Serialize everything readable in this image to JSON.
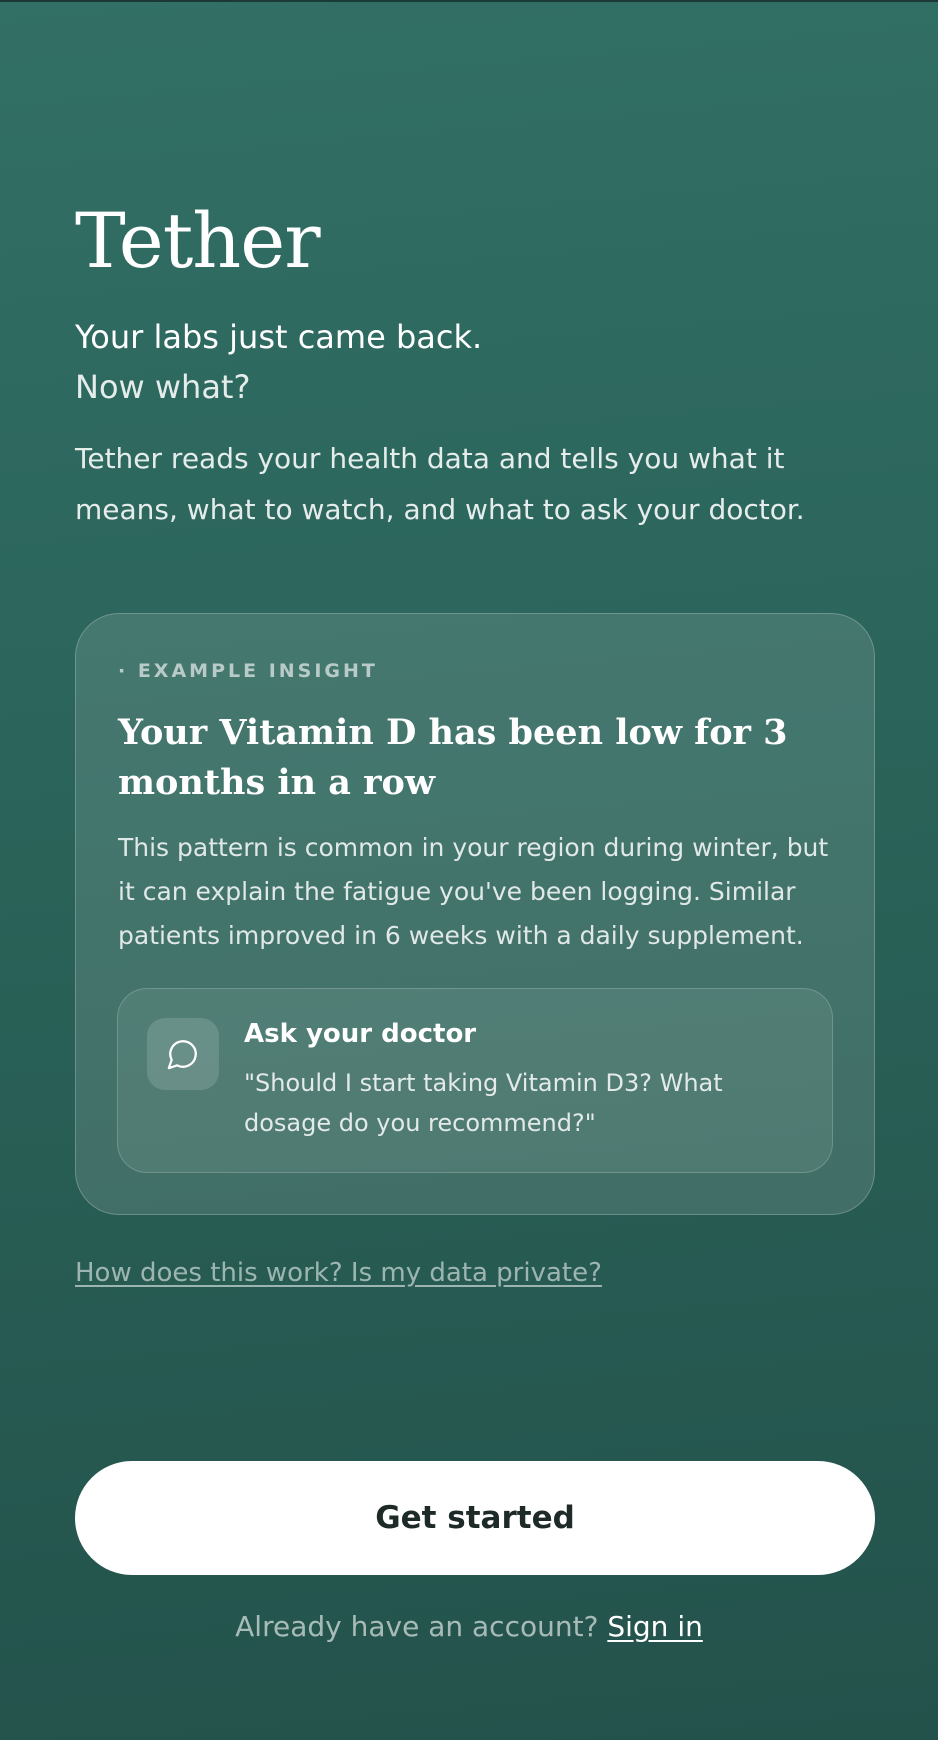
{
  "app": {
    "name": "Tether"
  },
  "hero": {
    "headline_line1": "Your labs just came back.",
    "headline_line2": "Now what?",
    "tagline": "Tether reads your health data and tells you what it means, what to watch, and what to ask your doctor."
  },
  "insight_card": {
    "eyebrow": "· EXAMPLE INSIGHT",
    "title": "Your Vitamin D has been low for 3 months in a row",
    "body": "This pattern is common in your region during winter, but it can explain the fatigue you've been logging. Similar patients improved in 6 weeks with a daily supplement.",
    "ask": {
      "icon": "chat-bubble-icon",
      "title": "Ask your doctor",
      "quote": "\"Should I start taking Vitamin D3? What dosage do you recommend?\""
    }
  },
  "links": {
    "privacy": "How does this work? Is my data private?"
  },
  "actions": {
    "get_started": "Get started",
    "signin_prompt": "Already have an account?",
    "signin_link": "Sign in"
  }
}
